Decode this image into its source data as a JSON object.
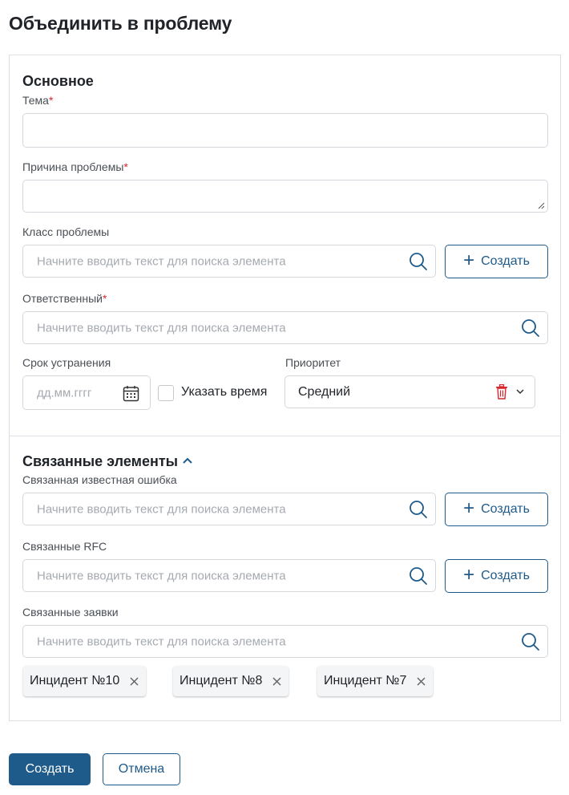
{
  "dialog": {
    "title": "Объединить в проблему"
  },
  "main": {
    "section_title": "Основное",
    "topic": {
      "label": "Тема",
      "required_mark": "*",
      "value": ""
    },
    "reason": {
      "label": "Причина проблемы",
      "required_mark": "*",
      "value": ""
    },
    "problem_class": {
      "label": "Класс проблемы",
      "placeholder": "Начните вводить текст для поиска элемента",
      "create_label": "Создать"
    },
    "responsible": {
      "label": "Ответственный",
      "required_mark": "*",
      "placeholder": "Начните вводить текст для поиска элемента"
    },
    "deadline": {
      "label": "Срок устранения",
      "placeholder": "дд.мм.гггг",
      "time_checkbox_label": "Указать время",
      "time_checked": false
    },
    "priority": {
      "label": "Приоритет",
      "value": "Средний"
    }
  },
  "related": {
    "section_title": "Связанные элементы",
    "known_error": {
      "label": "Связанная известная ошибка",
      "placeholder": "Начните вводить текст для поиска элемента",
      "create_label": "Создать"
    },
    "rfc": {
      "label": "Связанные RFC",
      "placeholder": "Начните вводить текст для поиска элемента",
      "create_label": "Создать"
    },
    "requests": {
      "label": "Связанные заявки",
      "placeholder": "Начните вводить текст для поиска элемента",
      "chips": [
        "Инцидент №10",
        "Инцидент №8",
        "Инцидент №7"
      ]
    }
  },
  "footer": {
    "submit_label": "Создать",
    "cancel_label": "Отмена"
  },
  "colors": {
    "accent": "#1e5a8a",
    "required": "#d9252b",
    "trash": "#d9252b"
  },
  "icons": [
    "search-icon",
    "plus-icon",
    "calendar-icon",
    "trash-icon",
    "chevron-down-icon",
    "chevron-up-icon",
    "close-icon"
  ]
}
